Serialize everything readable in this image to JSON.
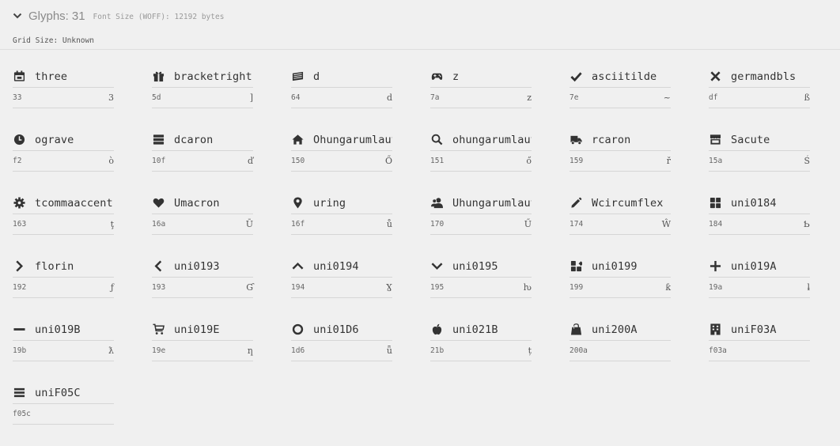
{
  "header": {
    "title": "Glyphs:",
    "count": "31",
    "font_size": "Font Size (WOFF): 12192 bytes",
    "grid_size": "Grid Size: Unknown"
  },
  "glyphs": [
    {
      "name": "three",
      "code": "33",
      "char": "3",
      "icon": "calendar-icon"
    },
    {
      "name": "bracketright",
      "code": "5d",
      "char": "]",
      "icon": "gift-icon"
    },
    {
      "name": "d",
      "code": "64",
      "char": "d",
      "icon": "money-icon"
    },
    {
      "name": "z",
      "code": "7a",
      "char": "z",
      "icon": "gamepad-icon"
    },
    {
      "name": "asciitilde",
      "code": "7e",
      "char": "~",
      "icon": "check-icon"
    },
    {
      "name": "germandbls",
      "code": "df",
      "char": "ß",
      "icon": "close-icon"
    },
    {
      "name": "ograve",
      "code": "f2",
      "char": "ò",
      "icon": "clock-icon"
    },
    {
      "name": "dcaron",
      "code": "10f",
      "char": "ď",
      "icon": "server-icon"
    },
    {
      "name": "Ohungarumlaut",
      "code": "150",
      "char": "Ő",
      "icon": "home-icon"
    },
    {
      "name": "ohungarumlaut",
      "code": "151",
      "char": "ő",
      "icon": "search-icon"
    },
    {
      "name": "rcaron",
      "code": "159",
      "char": "ř",
      "icon": "truck-icon"
    },
    {
      "name": "Sacute",
      "code": "15a",
      "char": "Ś",
      "icon": "store-icon"
    },
    {
      "name": "tcommaaccent",
      "code": "163",
      "char": "ţ",
      "icon": "gear-icon"
    },
    {
      "name": "Umacron",
      "code": "16a",
      "char": "Ū",
      "icon": "heart-icon"
    },
    {
      "name": "uring",
      "code": "16f",
      "char": "ů",
      "icon": "map-pin-icon"
    },
    {
      "name": "Uhungarumlaut",
      "code": "170",
      "char": "Ű",
      "icon": "users-icon"
    },
    {
      "name": "Wcircumflex",
      "code": "174",
      "char": "Ŵ",
      "icon": "pencil-icon"
    },
    {
      "name": "uni0184",
      "code": "184",
      "char": "Ƅ",
      "icon": "grid-icon"
    },
    {
      "name": "florin",
      "code": "192",
      "char": "ƒ",
      "icon": "chevron-right-icon"
    },
    {
      "name": "uni0193",
      "code": "193",
      "char": "Ɠ",
      "icon": "chevron-left-icon"
    },
    {
      "name": "uni0194",
      "code": "194",
      "char": "Ɣ",
      "icon": "chevron-up-icon"
    },
    {
      "name": "uni0195",
      "code": "195",
      "char": "ƕ",
      "icon": "chevron-down-icon"
    },
    {
      "name": "uni0199",
      "code": "199",
      "char": "ƙ",
      "icon": "shapes-icon"
    },
    {
      "name": "uni019A",
      "code": "19a",
      "char": "ƚ",
      "icon": "plus-icon"
    },
    {
      "name": "uni019B",
      "code": "19b",
      "char": "ƛ",
      "icon": "minus-icon"
    },
    {
      "name": "uni019E",
      "code": "19e",
      "char": "ƞ",
      "icon": "cart-icon"
    },
    {
      "name": "uni01D6",
      "code": "1d6",
      "char": "ǖ",
      "icon": "circle-icon"
    },
    {
      "name": "uni021B",
      "code": "21b",
      "char": "ț",
      "icon": "apple-icon"
    },
    {
      "name": "uni200A",
      "code": "200a",
      "char": "",
      "icon": "shopping-bag-icon"
    },
    {
      "name": "uniF03A",
      "code": "f03a",
      "char": "",
      "icon": "building-icon"
    },
    {
      "name": "uniF05C",
      "code": "f05c",
      "char": "",
      "icon": "list-icon"
    }
  ]
}
